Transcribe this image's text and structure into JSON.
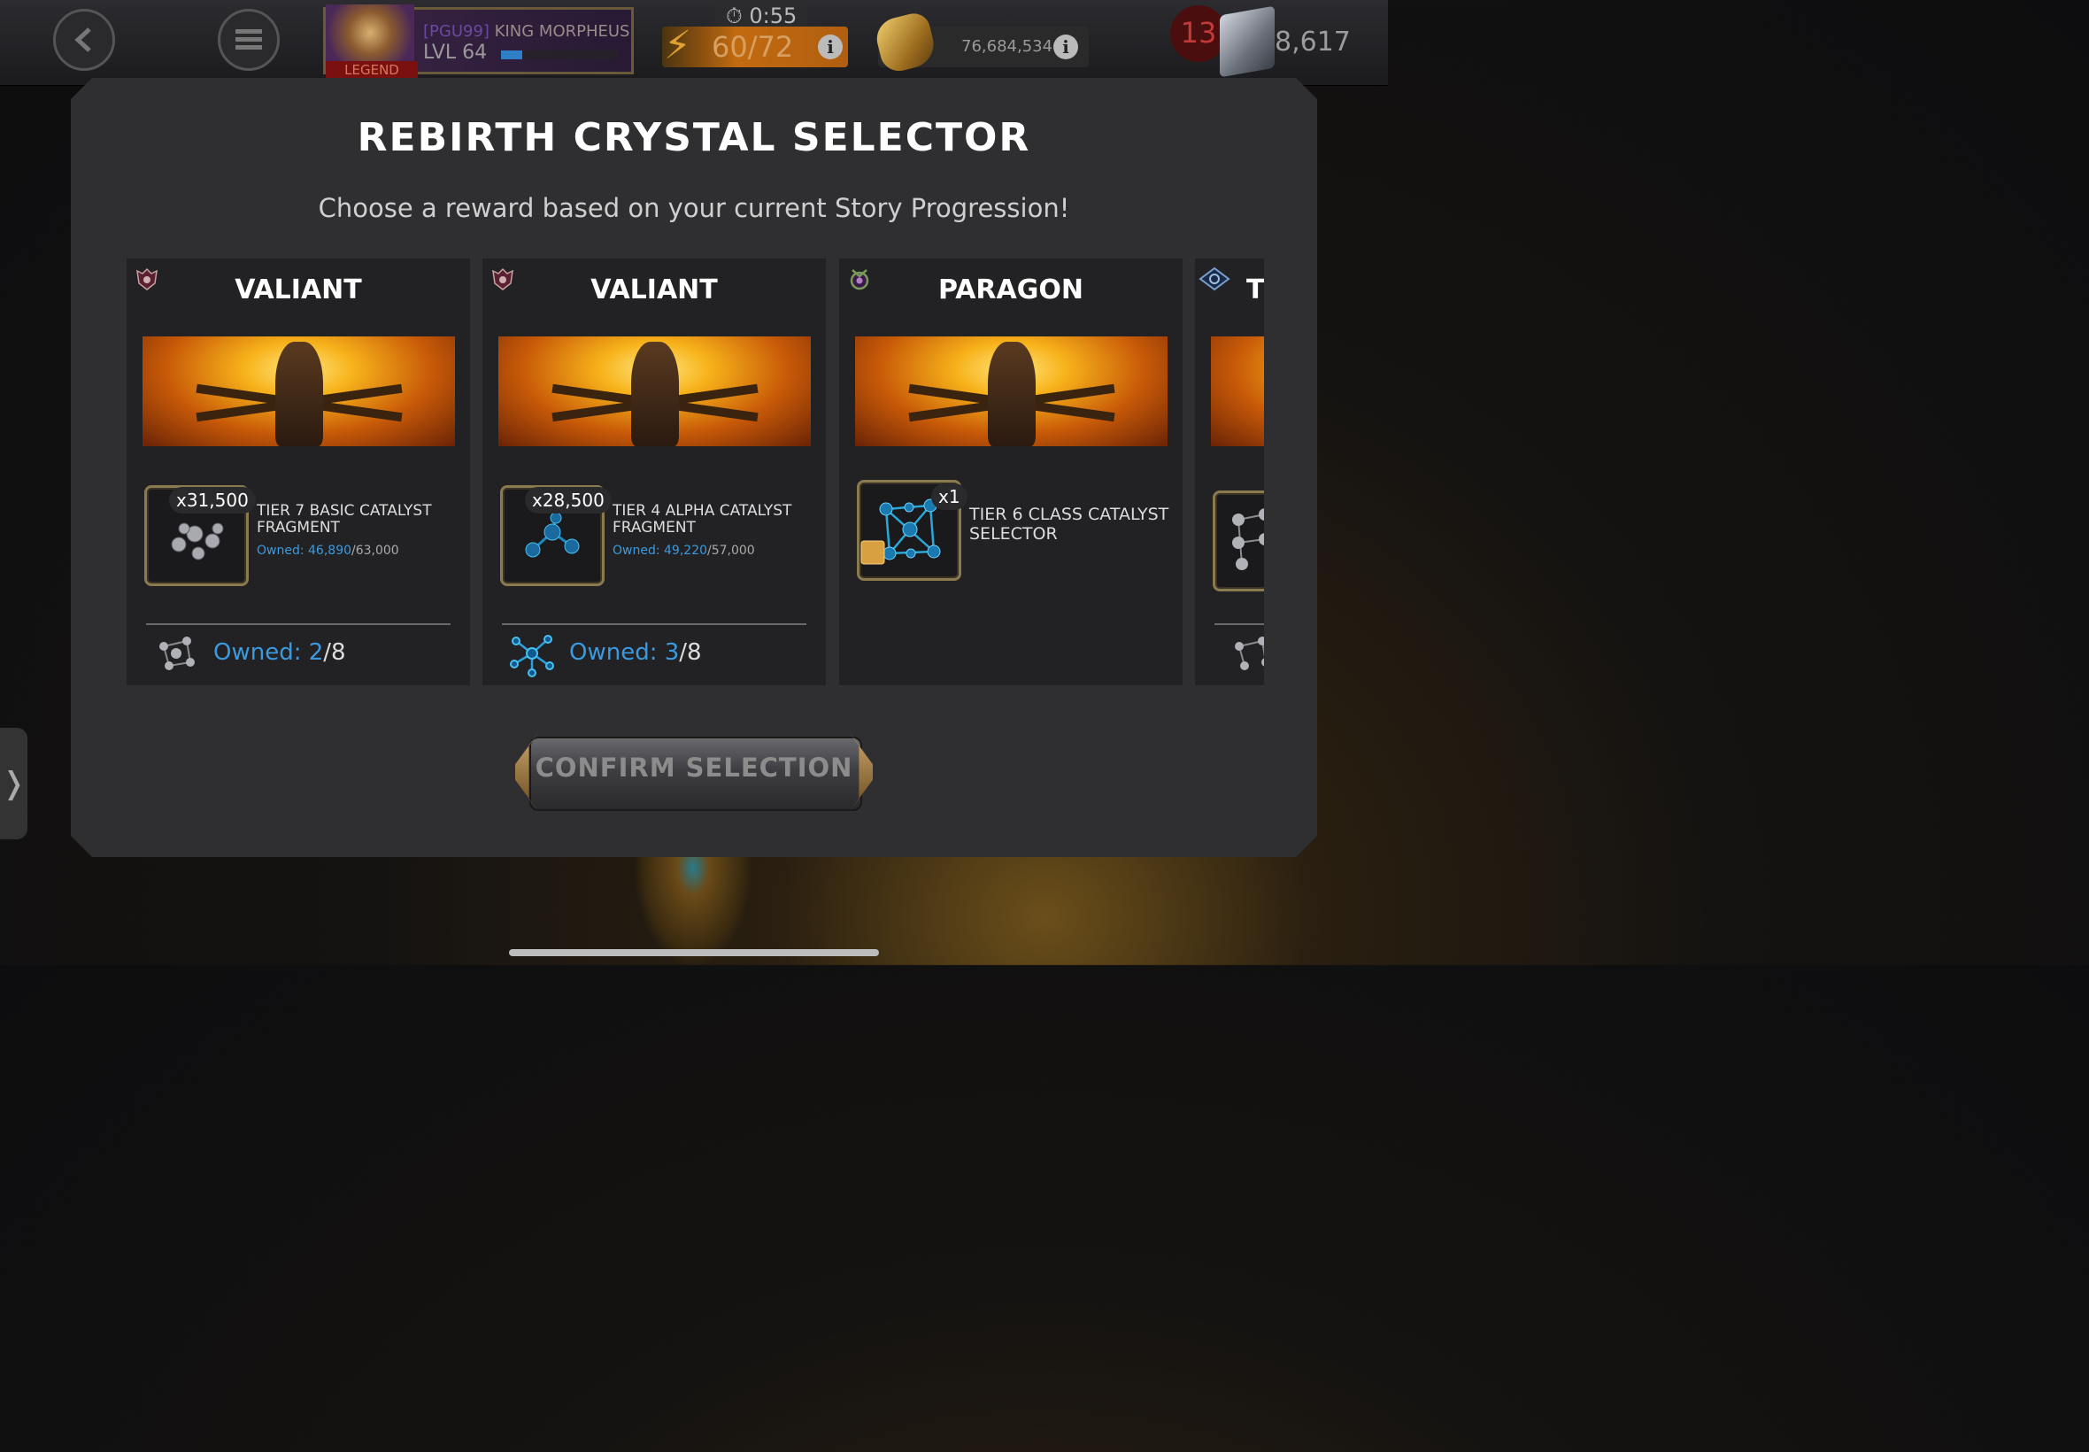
{
  "hud": {
    "player_tag": "[PGU99]",
    "player_name": "KING MORPHEUS",
    "level": "LVL 64",
    "level_progress": 0.18,
    "rank_badge": "LEGEND",
    "timer": "0:55",
    "energy": "60/72",
    "gold": "76,684,534",
    "notification_count": "13",
    "units": "8,617",
    "info_icon": "i"
  },
  "modal": {
    "title": "REBIRTH CRYSTAL SELECTOR",
    "subtitle": "Choose a reward based on your current Story Progression!",
    "confirm_label": "CONFIRM SELECTION",
    "cards": [
      {
        "title": "VALIANT",
        "item_count": "x31,500",
        "item_name": "TIER 7 BASIC CATALYST FRAGMENT",
        "item_owned_label": "Owned: ",
        "item_owned_current": "46,890",
        "item_owned_total": "/63,000",
        "footer_owned_label": "Owned: ",
        "footer_owned_current": "2",
        "footer_owned_total": "/8"
      },
      {
        "title": "VALIANT",
        "item_count": "x28,500",
        "item_name": "TIER 4 ALPHA CATALYST FRAGMENT",
        "item_owned_label": "Owned: ",
        "item_owned_current": "49,220",
        "item_owned_total": "/57,000",
        "footer_owned_label": "Owned: ",
        "footer_owned_current": "3",
        "footer_owned_total": "/8"
      },
      {
        "title": "PARAGON",
        "item_count": "x1",
        "item_name": "TIER 6 CLASS CATALYST SELECTOR"
      },
      {
        "title": "T"
      }
    ]
  },
  "side_tab": "❭",
  "colors": {
    "accent_blue": "#3a9ae0",
    "card_bg": "#222224",
    "modal_bg": "#2f2f31",
    "energy_orange": "#c26a10",
    "badge_red": "#4a0e0e"
  },
  "icons": [
    "back-icon",
    "menu-icon",
    "timer-icon",
    "energy-bolt-icon",
    "info-icon",
    "gold-icon",
    "units-icon",
    "valiant-class-icon",
    "paragon-class-icon",
    "thronebreaker-class-icon",
    "catalyst-fragment-icon",
    "catalyst-icon"
  ]
}
